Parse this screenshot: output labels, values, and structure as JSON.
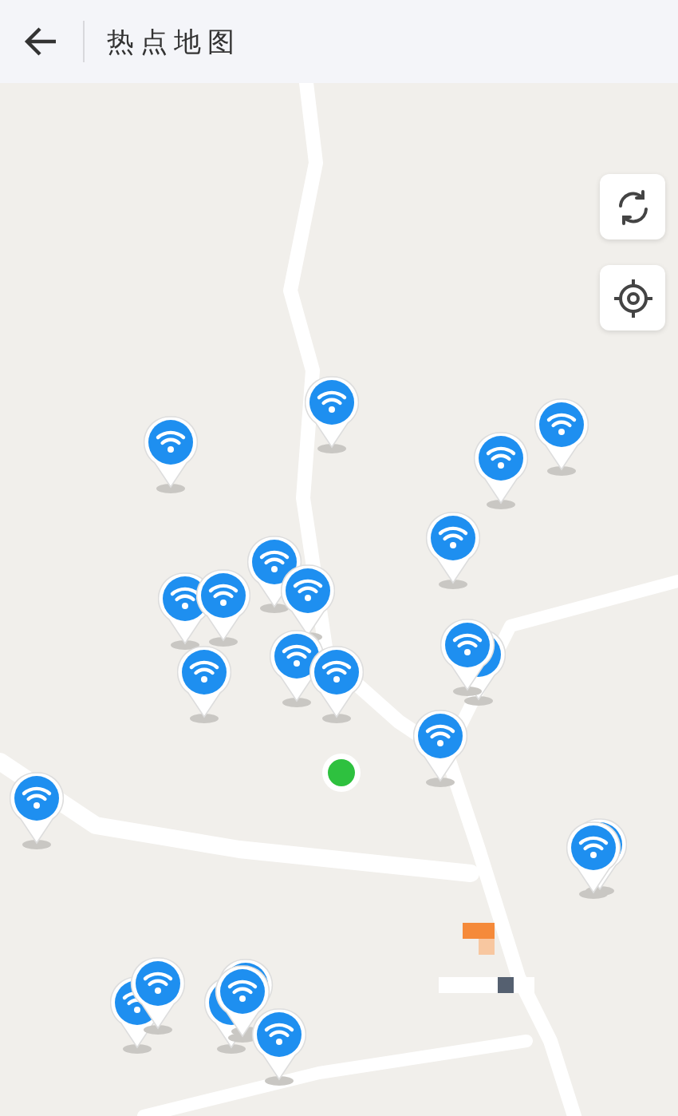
{
  "header": {
    "title": "热点地图"
  }
}
